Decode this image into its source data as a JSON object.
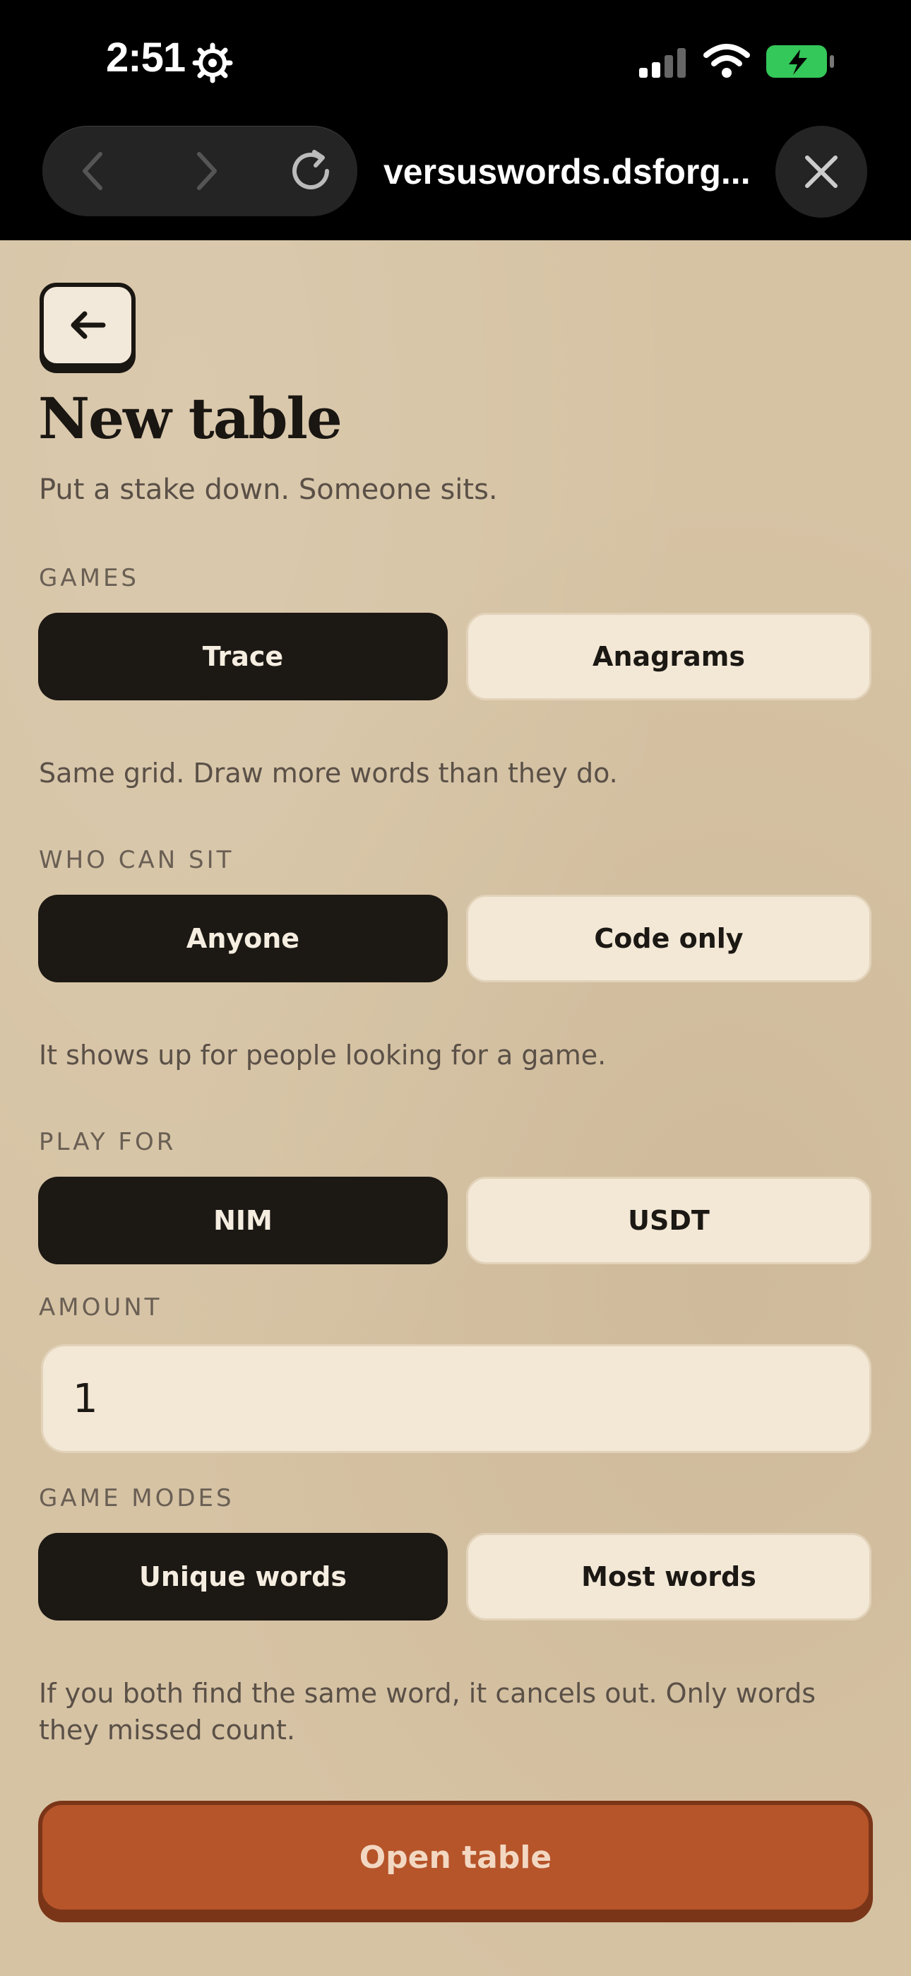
{
  "status_bar": {
    "time": "2:51",
    "icons": [
      "gear-icon",
      "cellular-signal-icon",
      "wifi-icon",
      "battery-charging-icon"
    ]
  },
  "browser": {
    "url": "versuswords.dsforg...",
    "icons": [
      "back-icon",
      "forward-icon",
      "reload-icon",
      "close-icon"
    ]
  },
  "page": {
    "back_icon": "arrow-left-icon",
    "title": "New table",
    "subtitle": "Put a stake down. Someone sits."
  },
  "games": {
    "label": "GAMES",
    "options": [
      "Trace",
      "Anagrams"
    ],
    "selected": "Trace",
    "help": "Same grid. Draw more words than they do."
  },
  "who_can_sit": {
    "label": "WHO CAN SIT",
    "options": [
      "Anyone",
      "Code only"
    ],
    "selected": "Anyone",
    "help": "It shows up for people looking for a game."
  },
  "play_for": {
    "label": "PLAY FOR",
    "options": [
      "NIM",
      "USDT"
    ],
    "selected": "NIM"
  },
  "amount": {
    "label": "AMOUNT",
    "value": "1"
  },
  "game_modes": {
    "label": "GAME MODES",
    "options": [
      "Unique words",
      "Most words"
    ],
    "selected": "Unique words",
    "help": "If you both find the same word, it cancels out. Only words they missed count."
  },
  "submit": {
    "label": "Open table"
  },
  "colors": {
    "background": "#d6c3a4",
    "active": "#1c1814",
    "inactive": "#f3e8d6",
    "accent": "#b6542a",
    "battery": "#34c759"
  }
}
